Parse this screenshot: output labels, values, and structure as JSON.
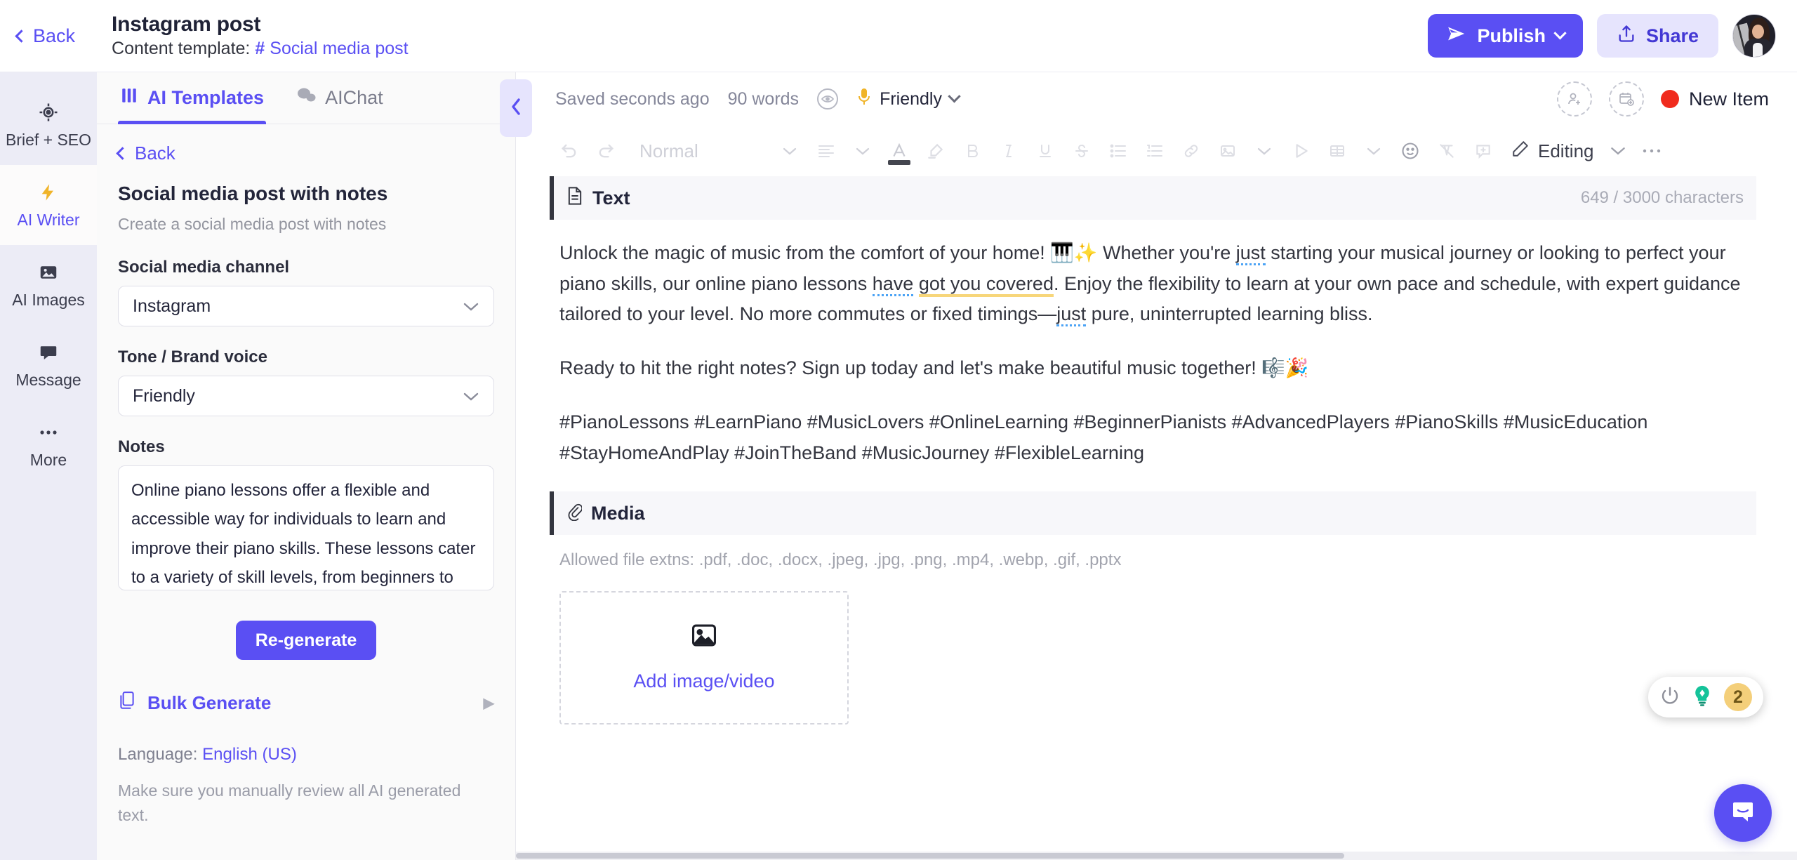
{
  "topbar": {
    "back_label": "Back",
    "doc_title": "Instagram post",
    "content_template_label": "Content template:",
    "template_hash": "#",
    "template_name": "Social media post",
    "publish_label": "Publish",
    "share_label": "Share",
    "publish_icon": "send-icon",
    "share_icon": "upload-icon",
    "avatar_name": "user-avatar"
  },
  "rail": {
    "items": [
      {
        "label": "Brief + SEO",
        "icon": "target-icon",
        "active": false
      },
      {
        "label": "AI Writer",
        "icon": "lightning-icon",
        "active": true
      },
      {
        "label": "AI Images",
        "icon": "image-icon",
        "active": false
      },
      {
        "label": "Message",
        "icon": "chat-bubble-icon",
        "active": false
      },
      {
        "label": "More",
        "icon": "ellipsis-icon",
        "active": false
      }
    ]
  },
  "panel": {
    "tabs": [
      {
        "label": "AI Templates",
        "icon": "templates-grid-icon",
        "active": true
      },
      {
        "label": "AIChat",
        "icon": "chat-bubbles-icon",
        "active": false
      }
    ],
    "back_label": "Back",
    "template_title": "Social media post with notes",
    "template_desc": "Create a social media post with notes",
    "channel_label": "Social media channel",
    "channel_value": "Instagram",
    "tone_label": "Tone / Brand voice",
    "tone_value": "Friendly",
    "notes_label": "Notes",
    "notes_value": "Online piano lessons offer a flexible and accessible way for individuals to learn and improve their piano skills. These lessons cater to a variety of skill levels, from beginners to advanced players.",
    "regenerate_label": "Re-generate",
    "bulk_generate_label": "Bulk Generate",
    "language_prefix": "Language:",
    "language_value": "English (US)",
    "disclaimer": "Make sure you manually review all AI generated text.",
    "collapse_icon": "chevron-left-icon"
  },
  "editor": {
    "saved_status": "Saved seconds ago",
    "word_count": "90 words",
    "visibility_icon": "eye-icon",
    "tone_icon": "microphone-icon",
    "tone_value": "Friendly",
    "add_user_icon": "add-user-icon",
    "add_calendar_icon": "add-calendar-icon",
    "status_label": "New Item",
    "status_color": "#f02b1d",
    "toolbar": {
      "undo": "undo-icon",
      "redo": "redo-icon",
      "style_value": "Normal",
      "align": "align-left-icon",
      "text_color": "text-color-icon",
      "highlight": "highlighter-icon",
      "bold": "bold-icon",
      "italic": "italic-icon",
      "underline": "underline-icon",
      "strikethrough": "strikethrough-icon",
      "bullet_list": "bullet-list-icon",
      "numbered_list": "numbered-list-icon",
      "link": "link-icon",
      "image": "image-insert-icon",
      "video": "video-play-icon",
      "table": "table-icon",
      "emoji": "emoji-icon",
      "clear_format": "clear-formatting-icon",
      "comment": "add-comment-icon",
      "mode_icon": "pencil-icon",
      "mode_label": "Editing",
      "more": "more-options-icon"
    },
    "text_section": {
      "icon": "document-icon",
      "title": "Text",
      "char_count": "649 / 3000 characters",
      "paragraphs": [
        "Unlock the magic of music from the comfort of your home! 🎹✨ Whether you're just starting your musical journey or looking to perfect your piano skills, our online piano lessons have got you covered. Enjoy the flexibility to learn at your own pace and schedule, with expert guidance tailored to your level. No more commutes or fixed timings—just pure, uninterrupted learning bliss.",
        "Ready to hit the right notes? Sign up today and let's make beautiful music together! 🎼🎉",
        "#PianoLessons #LearnPiano #MusicLovers #OnlineLearning #BeginnerPianists #AdvancedPlayers #PianoSkills #MusicEducation #StayHomeAndPlay #JoinTheBand #MusicJourney #FlexibleLearning"
      ]
    },
    "media_section": {
      "icon": "paperclip-icon",
      "title": "Media",
      "allowed_note": "Allowed file extns: .pdf, .doc, .docx, .jpeg, .jpg, .png, .mp4, .webp, .gif, .pptx",
      "dropzone_icon": "image-placeholder-icon",
      "dropzone_label": "Add image/video"
    }
  },
  "grammarly": {
    "power_icon": "power-icon",
    "suggestion_icon": "lightbulb-icon",
    "count": "2"
  },
  "intercom": {
    "icon": "intercom-chat-icon"
  },
  "colors": {
    "accent": "#5a4ff3",
    "accent_soft": "#e6e4fd",
    "status_red": "#f02b1d",
    "grammarly_green": "#15c39a"
  }
}
